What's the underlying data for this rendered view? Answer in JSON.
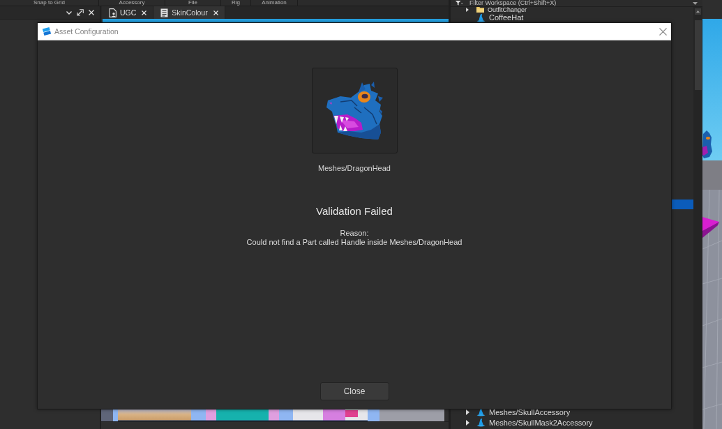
{
  "ribbon": {
    "labels": [
      "Snap to Grid",
      "Accessory",
      "File",
      "Rig",
      "Animation"
    ]
  },
  "editor_tabs": [
    {
      "label": "UGC",
      "kind": "place",
      "selected": true
    },
    {
      "label": "SkinColour",
      "kind": "script",
      "selected": false
    }
  ],
  "explorer": {
    "filter": {
      "placeholder": "Filter Workspace (Ctrl+Shift+X)"
    },
    "items": [
      {
        "name": "OutfitChanger",
        "kind": "folder",
        "has_children": true,
        "expanded": false,
        "selected": false
      },
      {
        "name": "CoffeeHat",
        "kind": "accessory",
        "has_children": false,
        "selected": false
      }
    ],
    "selection_behind_dialog": true,
    "items_bottom": [
      {
        "name": "Meshes/SkullAccessory",
        "kind": "accessory",
        "has_children": true,
        "expanded": false,
        "selected": false
      },
      {
        "name": "Meshes/SkullMask2Accessory",
        "kind": "accessory",
        "has_children": true,
        "expanded": false,
        "selected": false
      }
    ]
  },
  "dialog": {
    "title": "Asset Configuration",
    "asset_name": "Meshes/DragonHead",
    "status": "Validation Failed",
    "reason_label": "Reason:",
    "reason": "Could not find a Part called Handle inside Meshes/DragonHead",
    "buttons": [
      "Close"
    ]
  }
}
